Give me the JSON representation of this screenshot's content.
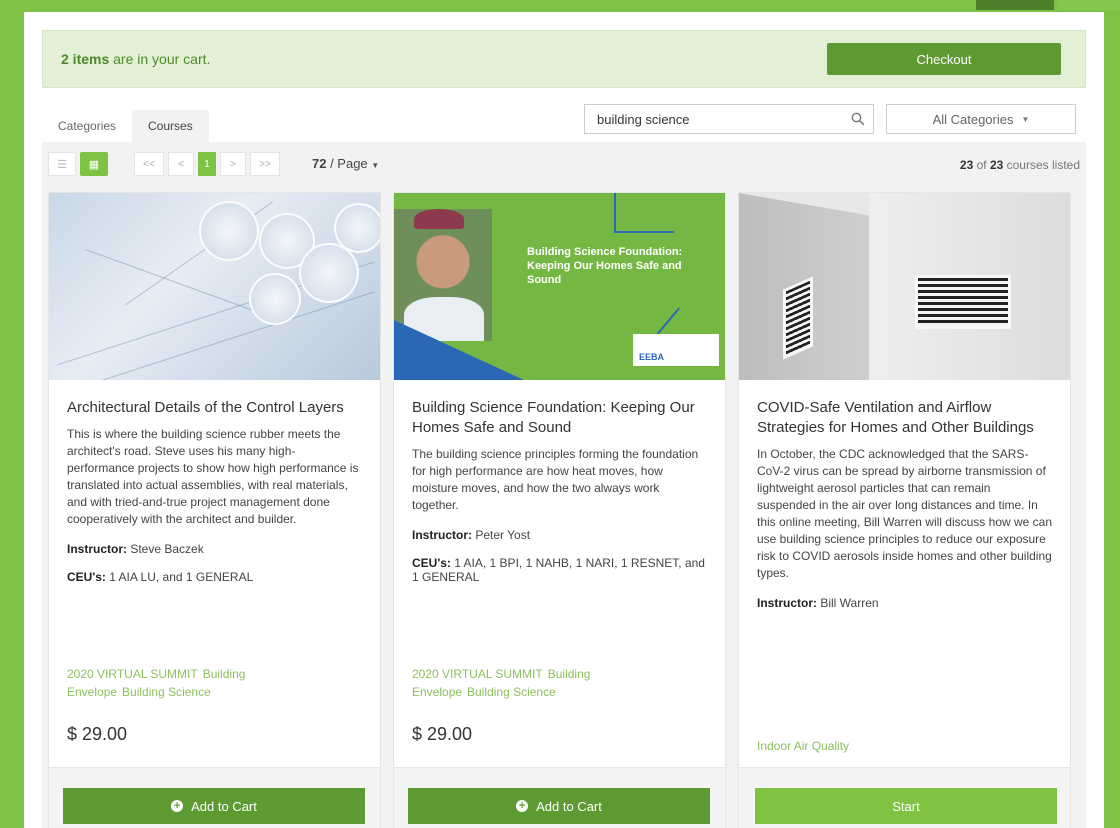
{
  "cart": {
    "count_text": "2 items",
    "message": " are in your cart.",
    "checkout_label": "Checkout"
  },
  "tabs": [
    {
      "label": "Categories"
    },
    {
      "label": "Courses"
    }
  ],
  "search": {
    "value": "building science",
    "placeholder": "Search"
  },
  "category_select": {
    "selected": "All Categories"
  },
  "pager": {
    "first": "<<",
    "prev": "<",
    "current": "1",
    "next": ">",
    "last": ">>",
    "per_page": "72",
    "per_page_suffix": " / Page",
    "count_shown": "23",
    "count_of": " of ",
    "count_total": "23",
    "count_suffix": " courses listed"
  },
  "cards": [
    {
      "title": "Architectural Details of the Control Layers",
      "description": "This is where the building science rubber meets the architect's road. Steve uses his many high-performance projects to show how high performance is translated into actual assemblies, with real materials, and with tried-and-true project management done cooperatively with the architect and builder.",
      "instructor_label": "Instructor:",
      "instructor": " Steve Baczek",
      "ceu_label": "CEU's:",
      "ceu": " 1 AIA LU, and 1 GENERAL",
      "tags": [
        "2020 VIRTUAL SUMMIT",
        "Building Envelope",
        "Building Science"
      ],
      "price": "$ 29.00",
      "button": "Add to Cart"
    },
    {
      "title": "Building Science Foundation: Keeping Our Homes Safe and Sound",
      "description": "The building science principles forming the foundation for high performance are how heat moves, how moisture moves, and how the two always work together.",
      "instructor_label": "Instructor:",
      "instructor": " Peter Yost",
      "ceu_label": "CEU's:",
      "ceu": " 1 AIA, 1 BPI, 1 NAHB, 1 NARI, 1 RESNET, and 1 GENERAL",
      "tags": [
        "2020 VIRTUAL SUMMIT",
        "Building Envelope",
        "Building Science"
      ],
      "price": "$ 29.00",
      "button": "Add to Cart",
      "thumb": {
        "title": "Building Science Foundation: Keeping Our Homes Safe and Sound",
        "logo": "EEBA"
      }
    },
    {
      "title": "COVID-Safe Ventilation and Airflow Strategies for Homes and Other Buildings",
      "description": "In October, the CDC acknowledged that the SARS-CoV-2 virus can be spread by airborne transmission of lightweight aerosol particles that can remain suspended in the air over long distances and time. In this online meeting, Bill Warren will discuss how we can use building science principles to reduce our exposure risk to COVID aerosols inside homes and other building types.",
      "instructor_label": "Instructor:",
      "instructor": " Bill Warren",
      "tags": [
        "Indoor Air Quality"
      ],
      "button": "Start"
    }
  ],
  "colors": {
    "brand_green": "#7dc242",
    "button_green": "#5e9a32",
    "tag_green": "#8dc05e"
  }
}
